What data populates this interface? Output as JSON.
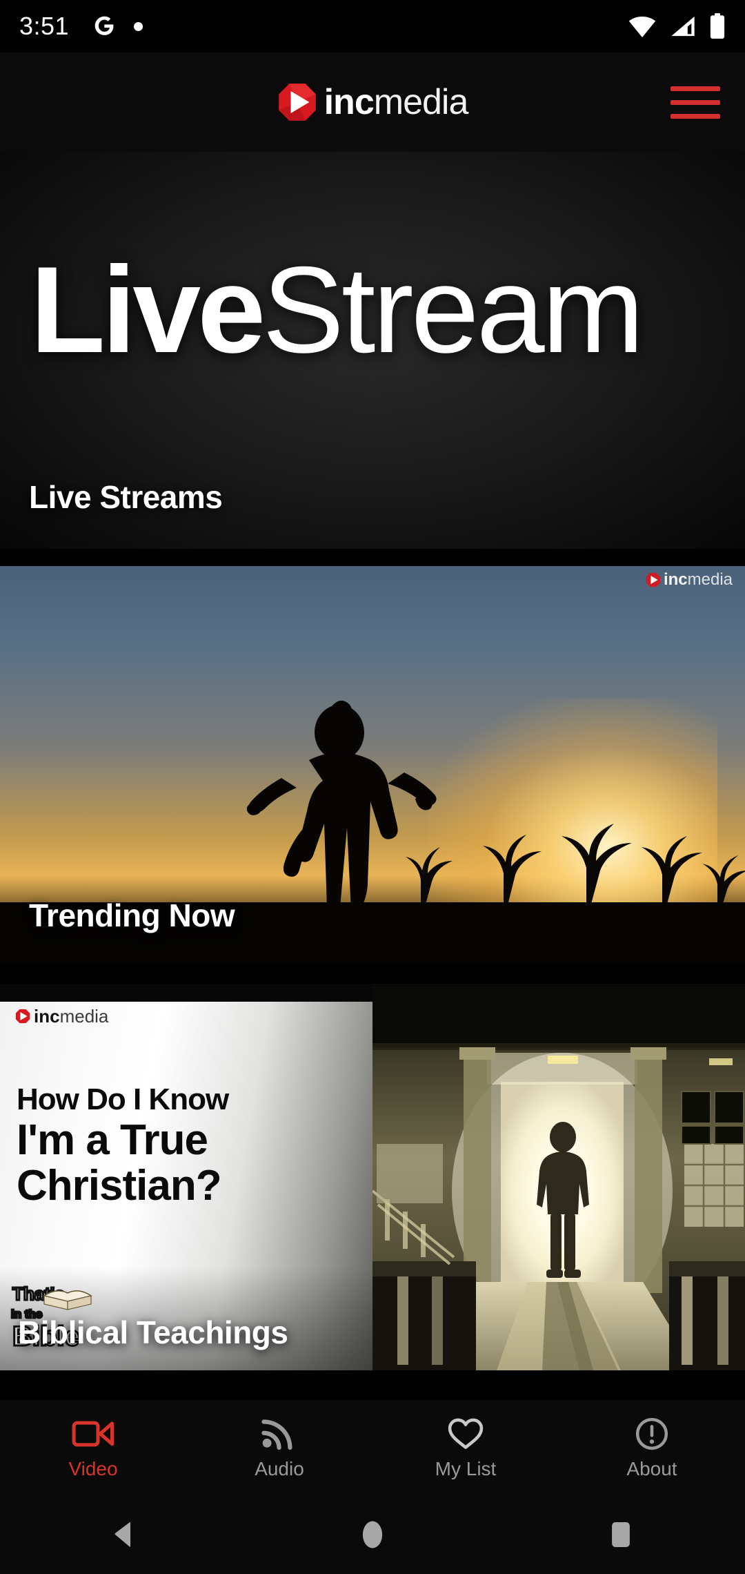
{
  "status_bar": {
    "time": "3:51",
    "icons": [
      "google-g-icon",
      "notification-dot-icon",
      "wifi-icon",
      "cellular-signal-icon",
      "battery-icon"
    ]
  },
  "app_bar": {
    "brand_bold": "inc",
    "brand_light": "media",
    "logo_icon": "incmedia-play-logo-icon",
    "menu_icon": "hamburger-menu-icon",
    "menu_color": "#d32f2f"
  },
  "hero": {
    "headline_bold": "Live",
    "headline_light": "Stream",
    "label": "Live Streams"
  },
  "cards": [
    {
      "label": "Trending Now",
      "watermark_bold": "inc",
      "watermark_light": "media",
      "watermark_icon": "incmedia-play-logo-icon"
    },
    {
      "label": "Biblical Teachings",
      "watermark_bold": "inc",
      "watermark_light": "media",
      "watermark_icon": "incmedia-play-logo-icon",
      "thumb_line1": "How Do I Know",
      "thumb_line2": "I'm a True",
      "thumb_line3": "Christian?",
      "badge_icon": "thats-in-the-bible-logo-icon"
    }
  ],
  "bottom_nav": {
    "active_color": "#d9342b",
    "inactive_color": "#9a9a9a",
    "items": [
      {
        "label": "Video",
        "icon": "video-camera-icon",
        "active": true
      },
      {
        "label": "Audio",
        "icon": "rss-waves-icon",
        "active": false
      },
      {
        "label": "My List",
        "icon": "heart-icon",
        "active": false
      },
      {
        "label": "About",
        "icon": "info-exclamation-circle-icon",
        "active": false
      }
    ]
  },
  "android_nav": {
    "back_icon": "back-triangle-icon",
    "home_icon": "home-circle-icon",
    "recents_icon": "recents-square-icon"
  }
}
